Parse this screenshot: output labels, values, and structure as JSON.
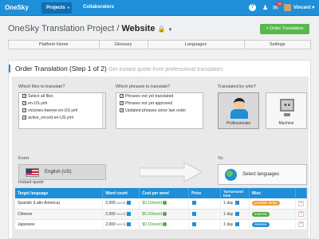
{
  "topbar": {
    "logo": "OneSky",
    "projects_label": "Projects",
    "collaborators_label": "Collaborators",
    "notification_count": "18",
    "user_name": "Vincent"
  },
  "header": {
    "project_name": "OneSky Translation Project /",
    "subproject_name": "Website",
    "order_button": "+ Order Translation"
  },
  "tabs": [
    "Platform Home",
    "Glossary",
    "Languages",
    "Settings"
  ],
  "order": {
    "title": "Order Translation (Step 1 of 2)",
    "subtitle": "Get instant quote from professional translators",
    "files_label": "Which files to translate?",
    "files": [
      {
        "label": "Select all files",
        "checked": true
      },
      {
        "label": "en-US.yml",
        "checked": true
      },
      {
        "label": "victories-banner.en-US.yml",
        "checked": true
      },
      {
        "label": "active_record.en-US.yml",
        "checked": true
      }
    ],
    "phrases_label": "Which phrases to translate?",
    "phrases": [
      {
        "label": "Phrases not yet translated",
        "checked": true
      },
      {
        "label": "Phrases not yet approved",
        "checked": true
      },
      {
        "label": "Updated phrases since last order",
        "checked": true
      }
    ],
    "translator_label": "Translated by who?",
    "translators": [
      "Professionals",
      "Machine"
    ],
    "from_label": "From:",
    "from_language": "English (US)",
    "to_label": "To:",
    "to_button": "Select languages"
  },
  "quote": {
    "label": "Instant quote",
    "headers": [
      "Target language",
      "Word count",
      "Cost per word",
      "Price",
      "Turnaround time",
      "Misc"
    ],
    "rows": [
      {
        "language": "Spanish (Latin America)",
        "word_count": "2,000",
        "cost": "$0.10/word",
        "turnaround": "1 day",
        "badge": "possible delay",
        "badge_color": "#f0a030"
      },
      {
        "language": "Chinese",
        "word_count": "2,000",
        "cost": "$0.20/word",
        "turnaround": "1 day",
        "badge": "express",
        "badge_color": "#4aae3a"
      },
      {
        "language": "Japanese",
        "word_count": "2,000",
        "cost": "$0.15/word",
        "turnaround": "1 day",
        "badge": "reviewe",
        "badge_color": "#1e8fd8"
      }
    ],
    "words_unit": "words"
  }
}
